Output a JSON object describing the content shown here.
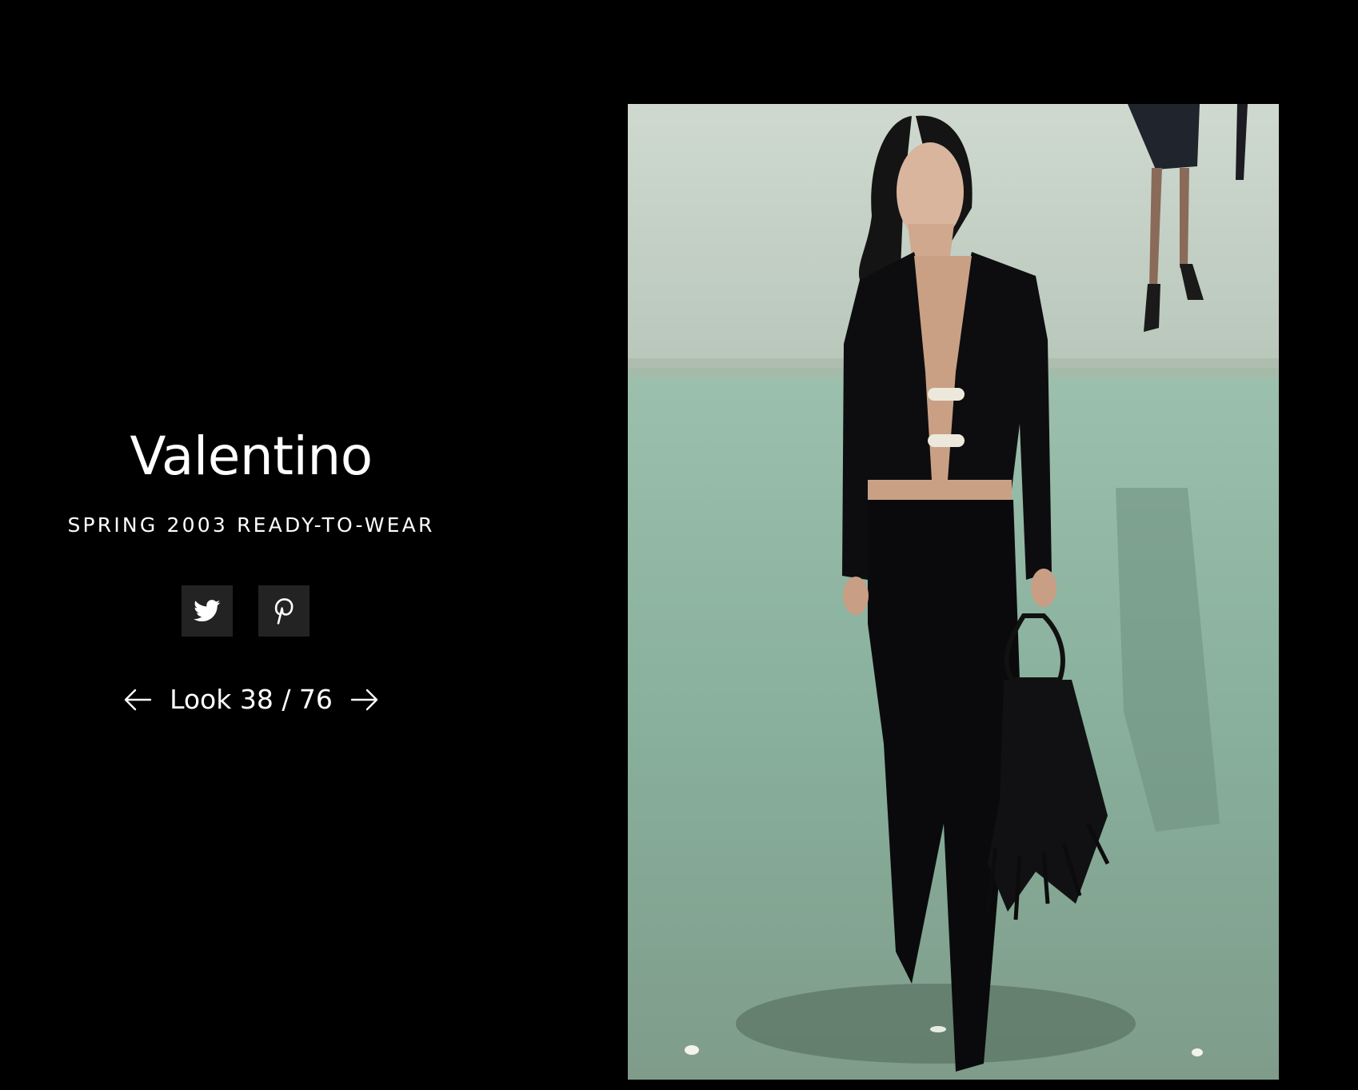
{
  "designer": "Valentino",
  "collection": "SPRING 2003 READY-TO-WEAR",
  "share": {
    "twitter_icon": "twitter-icon",
    "pinterest_icon": "pinterest-icon"
  },
  "pager": {
    "prev_icon": "arrow-left-icon",
    "label": "Look 38 / 76",
    "next_icon": "arrow-right-icon"
  },
  "colors": {
    "background": "#000000",
    "share_button_bg": "#232323",
    "text": "#ffffff"
  }
}
